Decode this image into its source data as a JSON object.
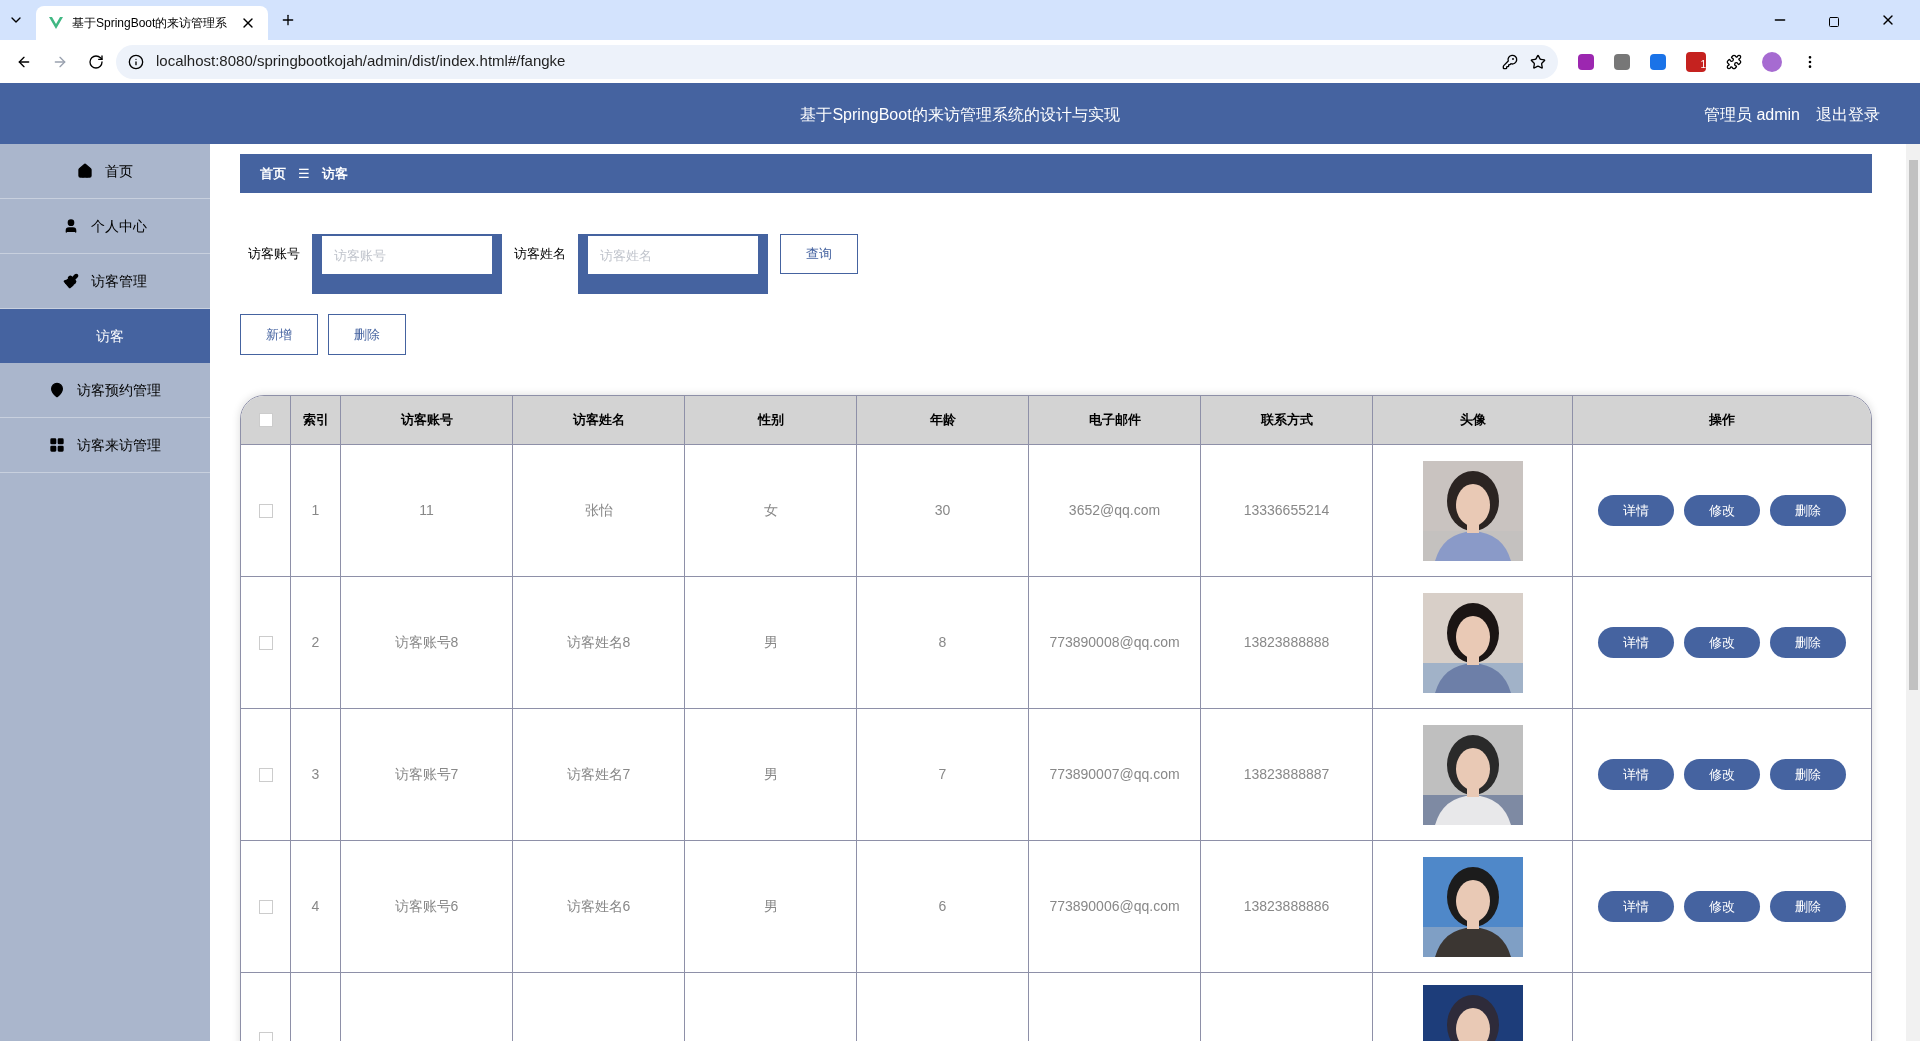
{
  "browser": {
    "tab_title": "基于SpringBoot的来访管理系",
    "url": "localhost:8080/springbootkojah/admin/dist/index.html#/fangke",
    "extension_badge": "1"
  },
  "header": {
    "title": "基于SpringBoot的来访管理系统的设计与实现",
    "user": "管理员 admin",
    "logout": "退出登录"
  },
  "sidebar": {
    "items": [
      {
        "label": "首页",
        "kind": "menu",
        "selected": false
      },
      {
        "label": "个人中心",
        "kind": "menu",
        "selected": false
      },
      {
        "label": "访客管理",
        "kind": "menu",
        "selected": false
      },
      {
        "label": "访客",
        "kind": "submenu",
        "selected": true
      },
      {
        "label": "访客预约管理",
        "kind": "menu",
        "selected": false
      },
      {
        "label": "访客来访管理",
        "kind": "menu",
        "selected": false
      }
    ]
  },
  "breadcrumb": {
    "home": "首页",
    "separator": "☰",
    "current": "访客"
  },
  "search": {
    "fields": [
      {
        "label": "访客账号",
        "placeholder": "访客账号"
      },
      {
        "label": "访客姓名",
        "placeholder": "访客姓名"
      }
    ],
    "button": "查询"
  },
  "actions": [
    "新增",
    "删除"
  ],
  "table": {
    "columns": [
      "索引",
      "访客账号",
      "访客姓名",
      "性别",
      "年龄",
      "电子邮件",
      "联系方式",
      "头像",
      "操作"
    ],
    "header_checked": false,
    "rows": [
      {
        "index": "1",
        "account": "11",
        "name": "张怡",
        "gender": "女",
        "age": "30",
        "email": "3652@qq.com",
        "phone": "13336655214",
        "checked": false,
        "buttons": [
          "详情",
          "修改",
          "删除"
        ]
      },
      {
        "index": "2",
        "account": "访客账号8",
        "name": "访客姓名8",
        "gender": "男",
        "age": "8",
        "email": "773890008@qq.com",
        "phone": "13823888888",
        "checked": false,
        "buttons": [
          "详情",
          "修改",
          "删除"
        ]
      },
      {
        "index": "3",
        "account": "访客账号7",
        "name": "访客姓名7",
        "gender": "男",
        "age": "7",
        "email": "773890007@qq.com",
        "phone": "13823888887",
        "checked": false,
        "buttons": [
          "详情",
          "修改",
          "删除"
        ]
      },
      {
        "index": "4",
        "account": "访客账号6",
        "name": "访客姓名6",
        "gender": "男",
        "age": "6",
        "email": "773890006@qq.com",
        "phone": "13823888886",
        "checked": false,
        "buttons": [
          "详情",
          "修改",
          "删除"
        ]
      }
    ],
    "partial_row": {
      "checked": false
    }
  }
}
